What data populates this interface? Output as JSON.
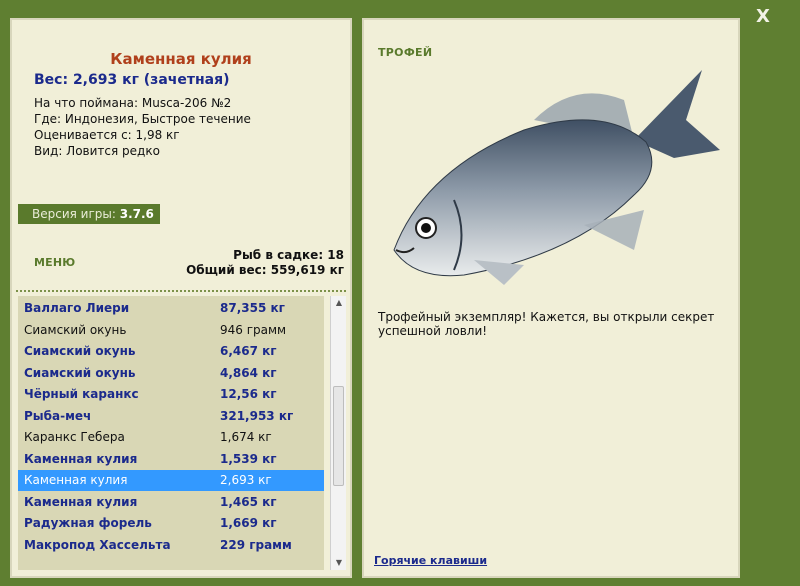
{
  "window": {
    "close_label": "X"
  },
  "fish": {
    "name": "Каменная кулия",
    "weight_line": "Вес: 2,693 кг (зачетная)",
    "caught_on": "На что поймана: Musca-206 №2",
    "location": "Где: Индонезия, Быстрое течение",
    "value": "Оценивается с: 1,98 кг",
    "rarity": "Вид: Ловится редко"
  },
  "version": {
    "label": "Версия игры:",
    "number": "3.7.6"
  },
  "menu": {
    "label": "МЕНЮ"
  },
  "keep": {
    "fish_count": "Рыб в садке: 18",
    "total_weight": "Общий вес: 559,619 кг"
  },
  "catch_list": [
    {
      "name": "Валлаго Лиери",
      "weight": "87,355 кг",
      "style": "bold"
    },
    {
      "name": "Сиамский окунь",
      "weight": "946 грамм",
      "style": "plain"
    },
    {
      "name": "Сиамский окунь",
      "weight": "6,467 кг",
      "style": "bold"
    },
    {
      "name": "Сиамский окунь",
      "weight": "4,864 кг",
      "style": "bold"
    },
    {
      "name": "Чёрный каранкс",
      "weight": "12,56 кг",
      "style": "bold"
    },
    {
      "name": "Рыба-меч",
      "weight": "321,953 кг",
      "style": "bold"
    },
    {
      "name": "Каранкс Гебера",
      "weight": "1,674 кг",
      "style": "plain"
    },
    {
      "name": "Каменная кулия",
      "weight": "1,539 кг",
      "style": "bold"
    },
    {
      "name": "Каменная кулия",
      "weight": "2,693 кг",
      "style": "selected"
    },
    {
      "name": "Каменная кулия",
      "weight": "1,465 кг",
      "style": "bold"
    },
    {
      "name": "Радужная форель",
      "weight": "1,669 кг",
      "style": "bold"
    },
    {
      "name": "Макропод Хассельта",
      "weight": "229 грамм",
      "style": "bold"
    }
  ],
  "trophy": {
    "title": "ТРОФЕЙ",
    "text": "Трофейный экземпляр! Кажется, вы открыли секрет успешной ловли!",
    "image_icon": "fish-picture"
  },
  "hotkeys": {
    "label": "Горячие клавиши"
  },
  "colors": {
    "frame_green": "#5f7f31",
    "panel_cream": "#f1efd8",
    "list_bg": "#d9d7b5",
    "selection_blue": "#3399ff",
    "name_navy": "#1b2a8c",
    "title_rust": "#b0401c"
  }
}
